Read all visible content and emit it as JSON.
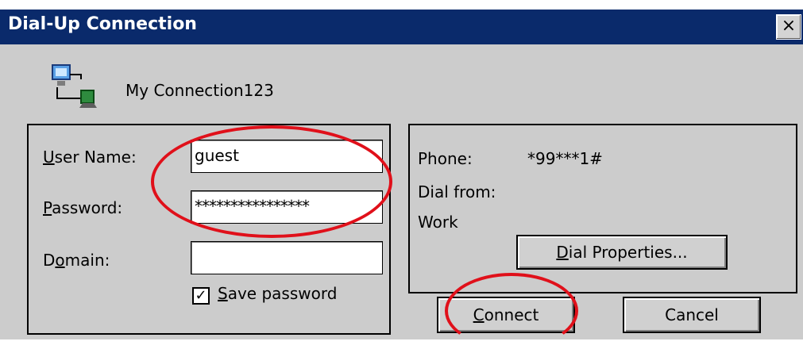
{
  "window": {
    "title": "Dial-Up Connection",
    "close_symbol": "×",
    "connection_icon": "network-computer-icon",
    "connection_name": "My Connection123"
  },
  "credentials": {
    "user_name_label": "ser Name:",
    "user_name_accel": "U",
    "user_name_value": "guest",
    "password_label": "assword:",
    "password_accel": "P",
    "password_value": "****************",
    "domain_label_a": "D",
    "domain_accel": "o",
    "domain_label_b": "main:",
    "domain_value": "",
    "save_password_accel": "S",
    "save_password_label": "ave password",
    "save_password_checked": true,
    "check_mark": "✓"
  },
  "dial_info": {
    "phone_label": "Phone:",
    "phone_value": "*99***1#",
    "dial_from_label": "Dial from:",
    "dial_from_value": "Work",
    "dial_properties_accel": "D",
    "dial_properties_label": "ial Properties..."
  },
  "actions": {
    "connect_accel": "C",
    "connect_label": "onnect",
    "cancel_label": "Cancel"
  },
  "colors": {
    "titlebar": "#0a2a6b",
    "dialog_bg": "#cccccc",
    "highlight_ellipse": "#e0101a"
  }
}
